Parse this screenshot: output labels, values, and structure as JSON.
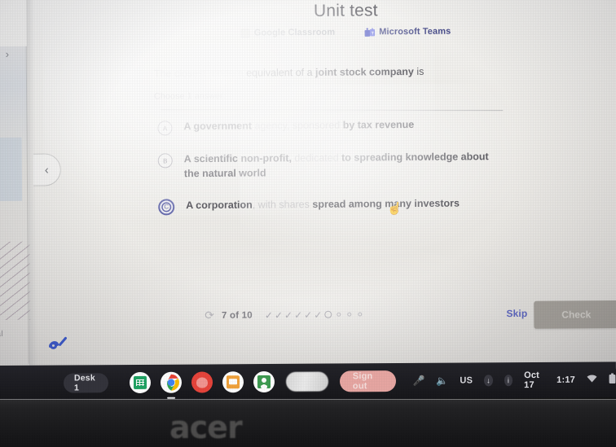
{
  "app": {
    "title": "Unit test",
    "share_links": [
      {
        "label": "Google Classroom",
        "icon": "google-classroom-icon"
      },
      {
        "label": "Microsoft Teams",
        "icon": "microsoft-teams-icon"
      }
    ]
  },
  "exercise": {
    "question_prefix": "The closest modern",
    "question_main": "equivalent of a ",
    "question_bold": "joint stock company",
    "question_suffix": " is",
    "choose_label": "Choose 1 answer:",
    "choices": [
      {
        "letter": "A",
        "text_lead": "A government ",
        "text_faded": "agency, sponsored",
        "text_tail": " by tax revenue",
        "selected": false
      },
      {
        "letter": "B",
        "text_lead": "A scientific non-profit,",
        "text_faded": " dedicated",
        "text_tail": " to spreading knowledge about the natural world",
        "selected": false
      },
      {
        "letter": "C",
        "text_lead": "A corporation",
        "text_faded": ", with shares",
        "text_tail": " spread among many investors",
        "selected": true
      }
    ]
  },
  "footer": {
    "refresh_icon": "refresh-icon",
    "progress_label": "7 of 10",
    "progress_dots": [
      "check",
      "check",
      "check",
      "check",
      "check",
      "check",
      "current",
      "empty",
      "empty",
      "empty"
    ],
    "skip_label": "Skip",
    "check_label": "Check",
    "check_enabled": false
  },
  "shelf": {
    "desk_label": "Desk 1",
    "apps": [
      {
        "name": "google-sheets-icon",
        "active": false
      },
      {
        "name": "google-chrome-icon",
        "active": true
      },
      {
        "name": "paint-app-icon",
        "active": false
      },
      {
        "name": "google-slides-icon",
        "active": false
      },
      {
        "name": "google-classroom-app-icon",
        "active": false
      },
      {
        "name": "blurred-app-icon",
        "active": false
      }
    ],
    "sign_out_label": "Sign out",
    "tray": {
      "mic_icon": "microphone-icon",
      "volume_icon": "volume-icon",
      "input_method": "US",
      "status_icon_1": "download-status-icon",
      "status_icon_2": "info-status-icon",
      "date": "Oct 17",
      "time": "1:17",
      "wifi_icon": "wifi-icon",
      "battery_icon": "battery-icon"
    }
  },
  "chrome_window": {
    "forward_chevron": "chevron-right-icon",
    "back_chevron": "chevron-left-icon",
    "edge_text_fragment": "al"
  },
  "device": {
    "brand_logo": "acer"
  },
  "colors": {
    "accent_blue": "#5c66c4",
    "selected_radio": "#5a5fa8",
    "teams_purple": "#4a4e8c",
    "check_button_bg": "#aaa69f",
    "sign_out_bg": "#e8a7a3",
    "shelf_bg": "#1d1d22"
  }
}
